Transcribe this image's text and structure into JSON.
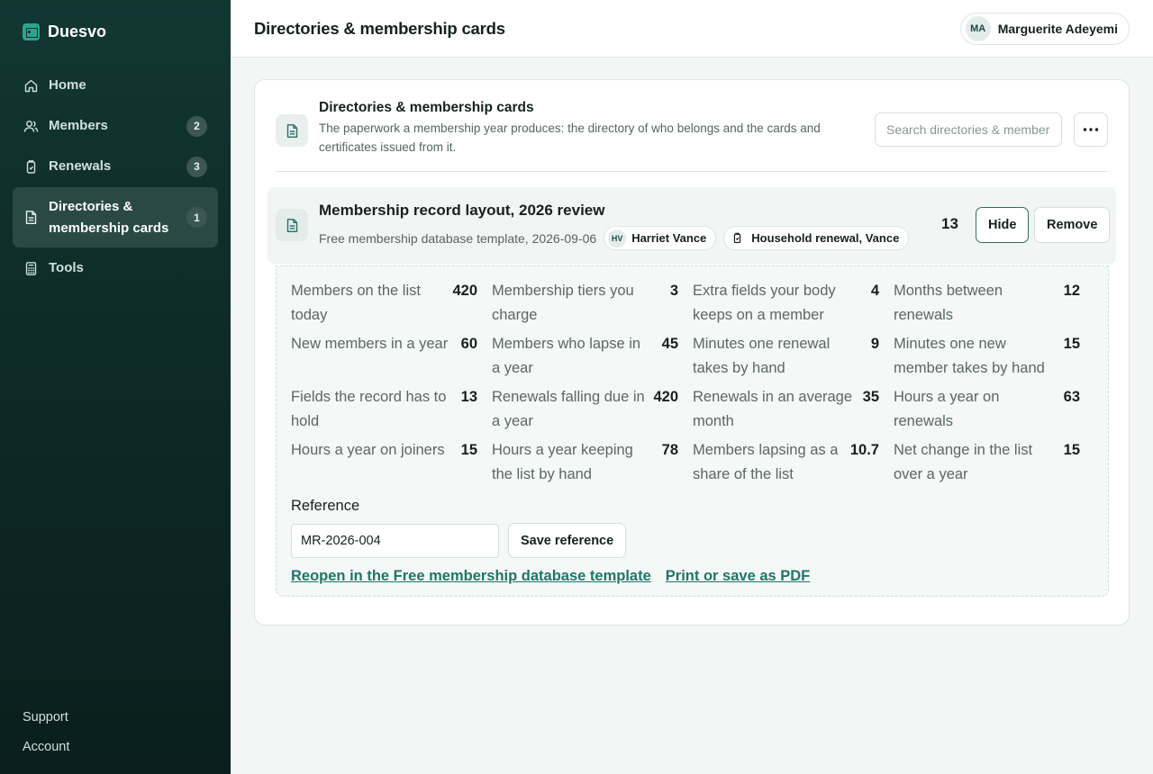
{
  "brand": {
    "name": "Duesvo",
    "icon": "id-card-icon"
  },
  "sidebar": {
    "items": [
      {
        "label": "Home",
        "icon": "home-icon",
        "badge": ""
      },
      {
        "label": "Members",
        "icon": "users-icon",
        "badge": "2"
      },
      {
        "label": "Renewals",
        "icon": "card-icon",
        "badge": "3"
      },
      {
        "label": "Directories & membership cards",
        "icon": "document-icon",
        "badge": "1",
        "active": true
      },
      {
        "label": "Tools",
        "icon": "calculator-icon",
        "badge": ""
      }
    ],
    "footer": {
      "support": "Support",
      "account": "Account"
    }
  },
  "header": {
    "title": "Directories & membership cards",
    "user": {
      "initials": "MA",
      "name": "Marguerite Adeyemi"
    }
  },
  "section": {
    "title": "Directories & membership cards",
    "description": "The paperwork a membership year produces: the directory of who belongs and the cards and certificates issued from it.",
    "search_placeholder": "Search directories & membership cards",
    "more_icon": "more-horizontal-icon"
  },
  "record": {
    "title": "Membership record layout, 2026 review",
    "source": "Free membership database template, 2026-09-06",
    "person_chip": {
      "initials": "HV",
      "name": "Harriet Vance"
    },
    "link_chip": {
      "label": "Household renewal, Vance",
      "icon": "card-icon"
    },
    "count": "13",
    "hide_label": "Hide",
    "remove_label": "Remove"
  },
  "stats": [
    {
      "label": "Members on the list today",
      "value": "420"
    },
    {
      "label": "Membership tiers you charge",
      "value": "3"
    },
    {
      "label": "Extra fields your body keeps on a member",
      "value": "4"
    },
    {
      "label": "Months between renewals",
      "value": "12"
    },
    {
      "label": "New members in a year",
      "value": "60"
    },
    {
      "label": "Members who lapse in a year",
      "value": "45"
    },
    {
      "label": "Minutes one renewal takes by hand",
      "value": "9"
    },
    {
      "label": "Minutes one new member takes by hand",
      "value": "15"
    },
    {
      "label": "Fields the record has to hold",
      "value": "13"
    },
    {
      "label": "Renewals falling due in a year",
      "value": "420"
    },
    {
      "label": "Renewals in an average month",
      "value": "35"
    },
    {
      "label": "Hours a year on renewals",
      "value": "63"
    },
    {
      "label": "Hours a year on joiners",
      "value": "15"
    },
    {
      "label": "Hours a year keeping the list by hand",
      "value": "78"
    },
    {
      "label": "Members lapsing as a share of the list",
      "value": "10.7"
    },
    {
      "label": "Net change in the list over a year",
      "value": "15"
    }
  ],
  "reference": {
    "label": "Reference",
    "value": "MR-2026-004",
    "save_label": "Save reference"
  },
  "links": {
    "reopen": "Reopen in the Free membership database template",
    "print": "Print or save as PDF"
  },
  "colors": {
    "sidebar": "#0e2a27",
    "accent": "#1f7568",
    "brand": "#2aa58c"
  }
}
